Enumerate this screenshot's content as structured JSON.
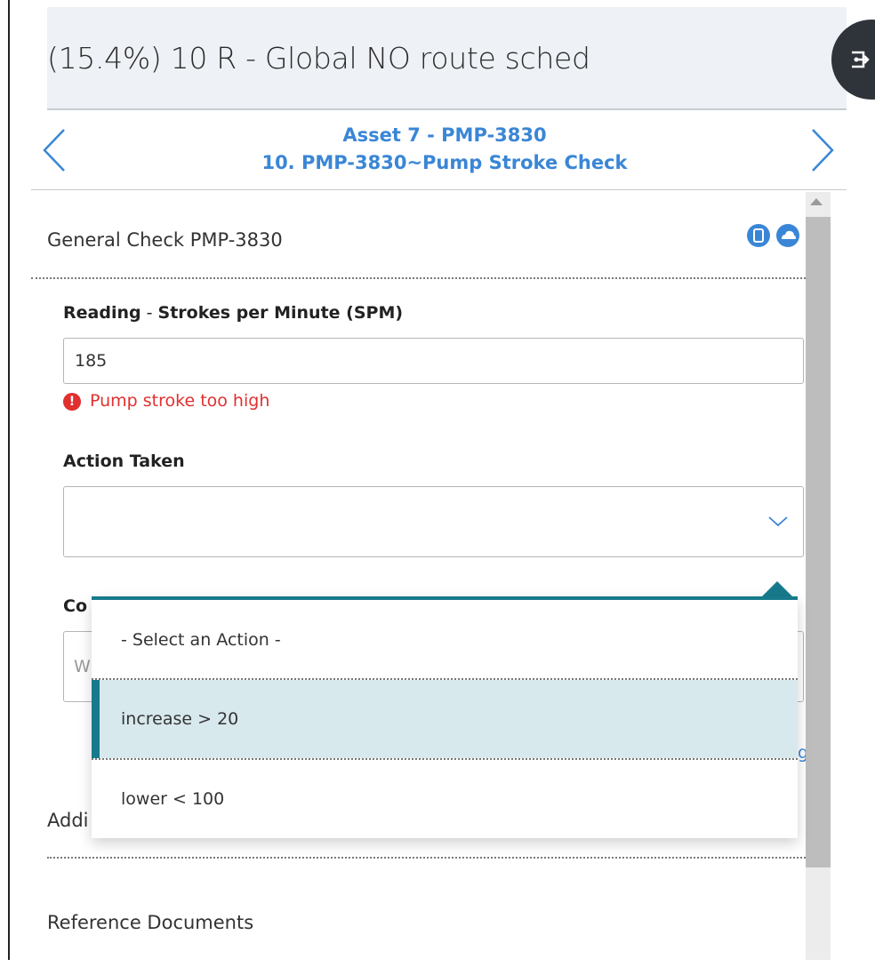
{
  "header": {
    "title": "(15.4%) 10 R - Global NO route sched"
  },
  "nav": {
    "asset_title": "Asset 7 - PMP-3830",
    "check_title": "10. PMP-3830~Pump Stroke Check"
  },
  "section": {
    "title": "General Check PMP-3830"
  },
  "reading": {
    "label_prefix": "Reading",
    "label_separator": " - ",
    "label_field": "Strokes per Minute (SPM)",
    "value": "185",
    "error_icon": "!",
    "error": "Pump stroke too high"
  },
  "action": {
    "label": "Action Taken",
    "selected": "",
    "options": [
      "- Select an Action -",
      "increase > 20",
      "lower < 100"
    ],
    "highlighted_index": 1
  },
  "comments": {
    "label_fragment": "Co",
    "placeholder_fragment": "W"
  },
  "link_fragment": "g",
  "additional": {
    "label_fragment": "Addi"
  },
  "reference_docs": {
    "label": "Reference Documents"
  },
  "colors": {
    "accent_blue": "#3a86d6",
    "teal": "#177a8c",
    "error_red": "#e0302f",
    "highlight_bg": "#d8e9ee"
  },
  "icons": {
    "exit": "exit-icon",
    "prev": "chevron-left-icon",
    "next": "chevron-right-icon",
    "device": "device-icon",
    "cloud": "cloud-icon",
    "error": "error-icon",
    "select": "chevron-down-icon"
  }
}
